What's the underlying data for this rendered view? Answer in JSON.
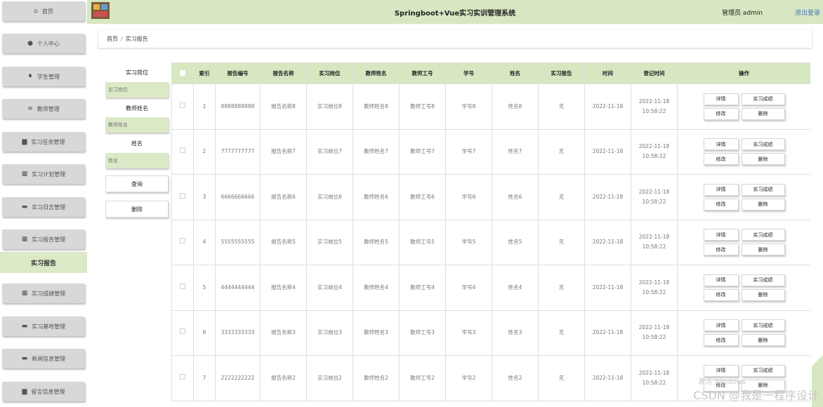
{
  "header": {
    "title": "Springboot+Vue实习实训管理系统",
    "user": "管理员 admin",
    "logout": "退出登录"
  },
  "sidebar": {
    "items": [
      {
        "label": "首页",
        "icon": "home-icon"
      },
      {
        "label": "个人中心",
        "icon": "user-icon"
      },
      {
        "label": "学生管理",
        "icon": "location-icon"
      },
      {
        "label": "教师管理",
        "icon": "list-icon"
      },
      {
        "label": "实习任务管理",
        "icon": "folder-icon"
      },
      {
        "label": "实习计划管理",
        "icon": "grid-icon"
      },
      {
        "label": "实习日志管理",
        "icon": "monitor-icon"
      },
      {
        "label": "实习报告管理",
        "icon": "grid-icon"
      },
      {
        "label": "实习成绩管理",
        "icon": "grid-icon"
      },
      {
        "label": "实习基地管理",
        "icon": "monitor-icon"
      },
      {
        "label": "新闻信息管理",
        "icon": "monitor-icon"
      },
      {
        "label": "留言信息管理",
        "icon": "folder-icon"
      }
    ],
    "active_sub": "实习报告"
  },
  "breadcrumb": {
    "home": "首页",
    "separator": "/",
    "current": "实习报告"
  },
  "search": {
    "label1": "实习岗位",
    "placeholder1": "实习岗位",
    "label2": "教师姓名",
    "placeholder2": "教师姓名",
    "label3": "姓名",
    "placeholder3": "姓名",
    "query_btn": "查询",
    "delete_btn": "删除"
  },
  "table": {
    "headers": [
      "索引",
      "报告编号",
      "报告名称",
      "实习岗位",
      "教师姓名",
      "教师工号",
      "学号",
      "姓名",
      "实习报告",
      "时间",
      "登记时间",
      "操作"
    ],
    "rows": [
      {
        "idx": "1",
        "code": "8888888888",
        "name": "报告名称8",
        "post": "实习岗位8",
        "teacher": "教师姓名8",
        "tno": "教师工号8",
        "sno": "学号8",
        "sname": "姓名8",
        "report": "无",
        "date": "2022-11-18",
        "reg1": "2022-11-18",
        "reg2": "10:58:22"
      },
      {
        "idx": "2",
        "code": "7777777777",
        "name": "报告名称7",
        "post": "实习岗位7",
        "teacher": "教师姓名7",
        "tno": "教师工号7",
        "sno": "学号7",
        "sname": "姓名7",
        "report": "无",
        "date": "2022-11-18",
        "reg1": "2022-11-18",
        "reg2": "10:58:22"
      },
      {
        "idx": "3",
        "code": "6666666666",
        "name": "报告名称6",
        "post": "实习岗位6",
        "teacher": "教师姓名6",
        "tno": "教师工号6",
        "sno": "学号6",
        "sname": "姓名6",
        "report": "无",
        "date": "2022-11-18",
        "reg1": "2022-11-18",
        "reg2": "10:58:22"
      },
      {
        "idx": "4",
        "code": "5555555555",
        "name": "报告名称5",
        "post": "实习岗位5",
        "teacher": "教师姓名5",
        "tno": "教师工号5",
        "sno": "学号5",
        "sname": "姓名5",
        "report": "无",
        "date": "2022-11-18",
        "reg1": "2022-11-18",
        "reg2": "10:58:22"
      },
      {
        "idx": "5",
        "code": "4444444444",
        "name": "报告名称4",
        "post": "实习岗位4",
        "teacher": "教师姓名4",
        "tno": "教师工号4",
        "sno": "学号4",
        "sname": "姓名4",
        "report": "无",
        "date": "2022-11-18",
        "reg1": "2022-11-18",
        "reg2": "10:58:22"
      },
      {
        "idx": "6",
        "code": "3333333333",
        "name": "报告名称3",
        "post": "实习岗位3",
        "teacher": "教师姓名3",
        "tno": "教师工号3",
        "sno": "学号3",
        "sname": "姓名3",
        "report": "无",
        "date": "2022-11-18",
        "reg1": "2022-11-18",
        "reg2": "10:58:22"
      },
      {
        "idx": "7",
        "code": "2222222222",
        "name": "报告名称2",
        "post": "实习岗位2",
        "teacher": "教师姓名2",
        "tno": "教师工号2",
        "sno": "学号2",
        "sname": "姓名2",
        "report": "无",
        "date": "2022-11-18",
        "reg1": "2022-11-18",
        "reg2": "10:58:22"
      }
    ],
    "ops": {
      "detail": "详情",
      "score": "实习成绩",
      "edit": "修改",
      "delete": "删除"
    }
  },
  "overlay": {
    "watermark": "CSDN @我是一程序设计",
    "activate": "激活 Windows"
  },
  "colors": {
    "accent": "#d6e7c2",
    "menu": "#d8d8d8"
  }
}
